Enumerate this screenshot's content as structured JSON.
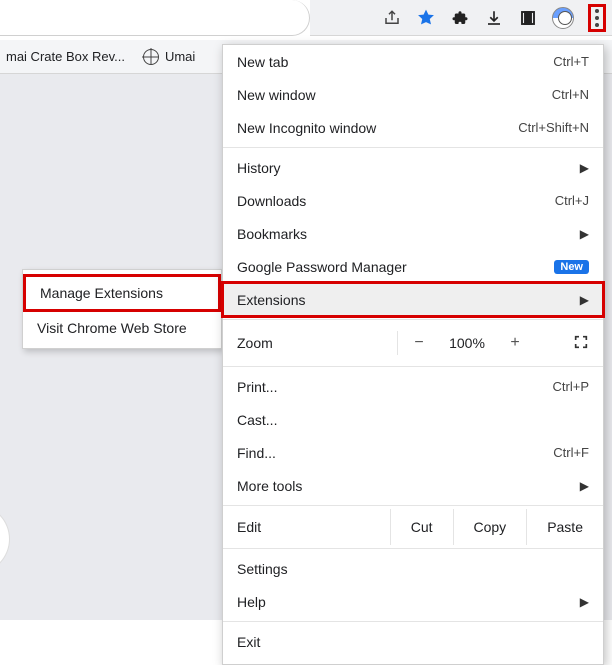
{
  "toolbar": {
    "icons": {
      "share": "share-icon",
      "bookmark": "star-filled-icon",
      "extensions": "puzzle-icon",
      "downloads": "download-icon",
      "reader": "reader-icon",
      "avatar": "avatar-icon",
      "more": "more-vert-icon"
    }
  },
  "bookmarks": {
    "item1": "mai Crate Box Rev...",
    "item2": "Umai"
  },
  "submenu": {
    "manage": "Manage Extensions",
    "store": "Visit Chrome Web Store"
  },
  "menu": {
    "new_tab": {
      "label": "New tab",
      "accel": "Ctrl+T"
    },
    "new_window": {
      "label": "New window",
      "accel": "Ctrl+N"
    },
    "incognito": {
      "label": "New Incognito window",
      "accel": "Ctrl+Shift+N"
    },
    "history": {
      "label": "History"
    },
    "downloads": {
      "label": "Downloads",
      "accel": "Ctrl+J"
    },
    "bookmarks": {
      "label": "Bookmarks"
    },
    "pwmgr": {
      "label": "Google Password Manager",
      "badge": "New"
    },
    "extensions": {
      "label": "Extensions"
    },
    "zoom": {
      "label": "Zoom",
      "minus": "−",
      "value": "100%",
      "plus": "+"
    },
    "print": {
      "label": "Print...",
      "accel": "Ctrl+P"
    },
    "cast": {
      "label": "Cast..."
    },
    "find": {
      "label": "Find...",
      "accel": "Ctrl+F"
    },
    "more_tools": {
      "label": "More tools"
    },
    "edit": {
      "label": "Edit",
      "cut": "Cut",
      "copy": "Copy",
      "paste": "Paste"
    },
    "settings": {
      "label": "Settings"
    },
    "help": {
      "label": "Help"
    },
    "exit": {
      "label": "Exit"
    }
  },
  "colors": {
    "highlight_border": "#d60000",
    "badge_bg": "#1a73e8"
  }
}
